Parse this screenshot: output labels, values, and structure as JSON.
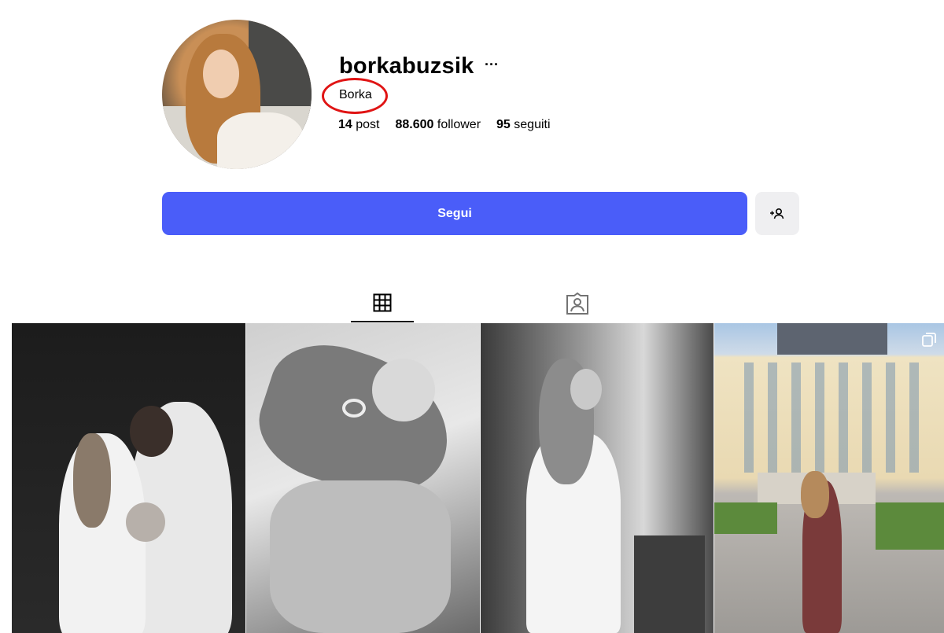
{
  "profile": {
    "username": "borkabuzsik",
    "more_label": "···",
    "full_name": "Borka",
    "stats": {
      "posts_value": "14",
      "posts_label": "post",
      "followers_value": "88.600",
      "followers_label": "follower",
      "following_value": "95",
      "following_label": "seguiti"
    }
  },
  "actions": {
    "follow_label": "Segui",
    "suggest_icon": "add-person-icon"
  },
  "tabs": [
    {
      "icon": "grid-icon",
      "active": true
    },
    {
      "icon": "tagged-icon",
      "active": false
    }
  ],
  "posts": [
    {
      "description": "photo-family-newborn"
    },
    {
      "description": "photo-hands-baby"
    },
    {
      "description": "photo-pregnant-window"
    },
    {
      "description": "photo-castle-garden",
      "multi": true
    }
  ],
  "colors": {
    "follow_button": "#4a5df9",
    "annotation_circle": "#e01414"
  }
}
